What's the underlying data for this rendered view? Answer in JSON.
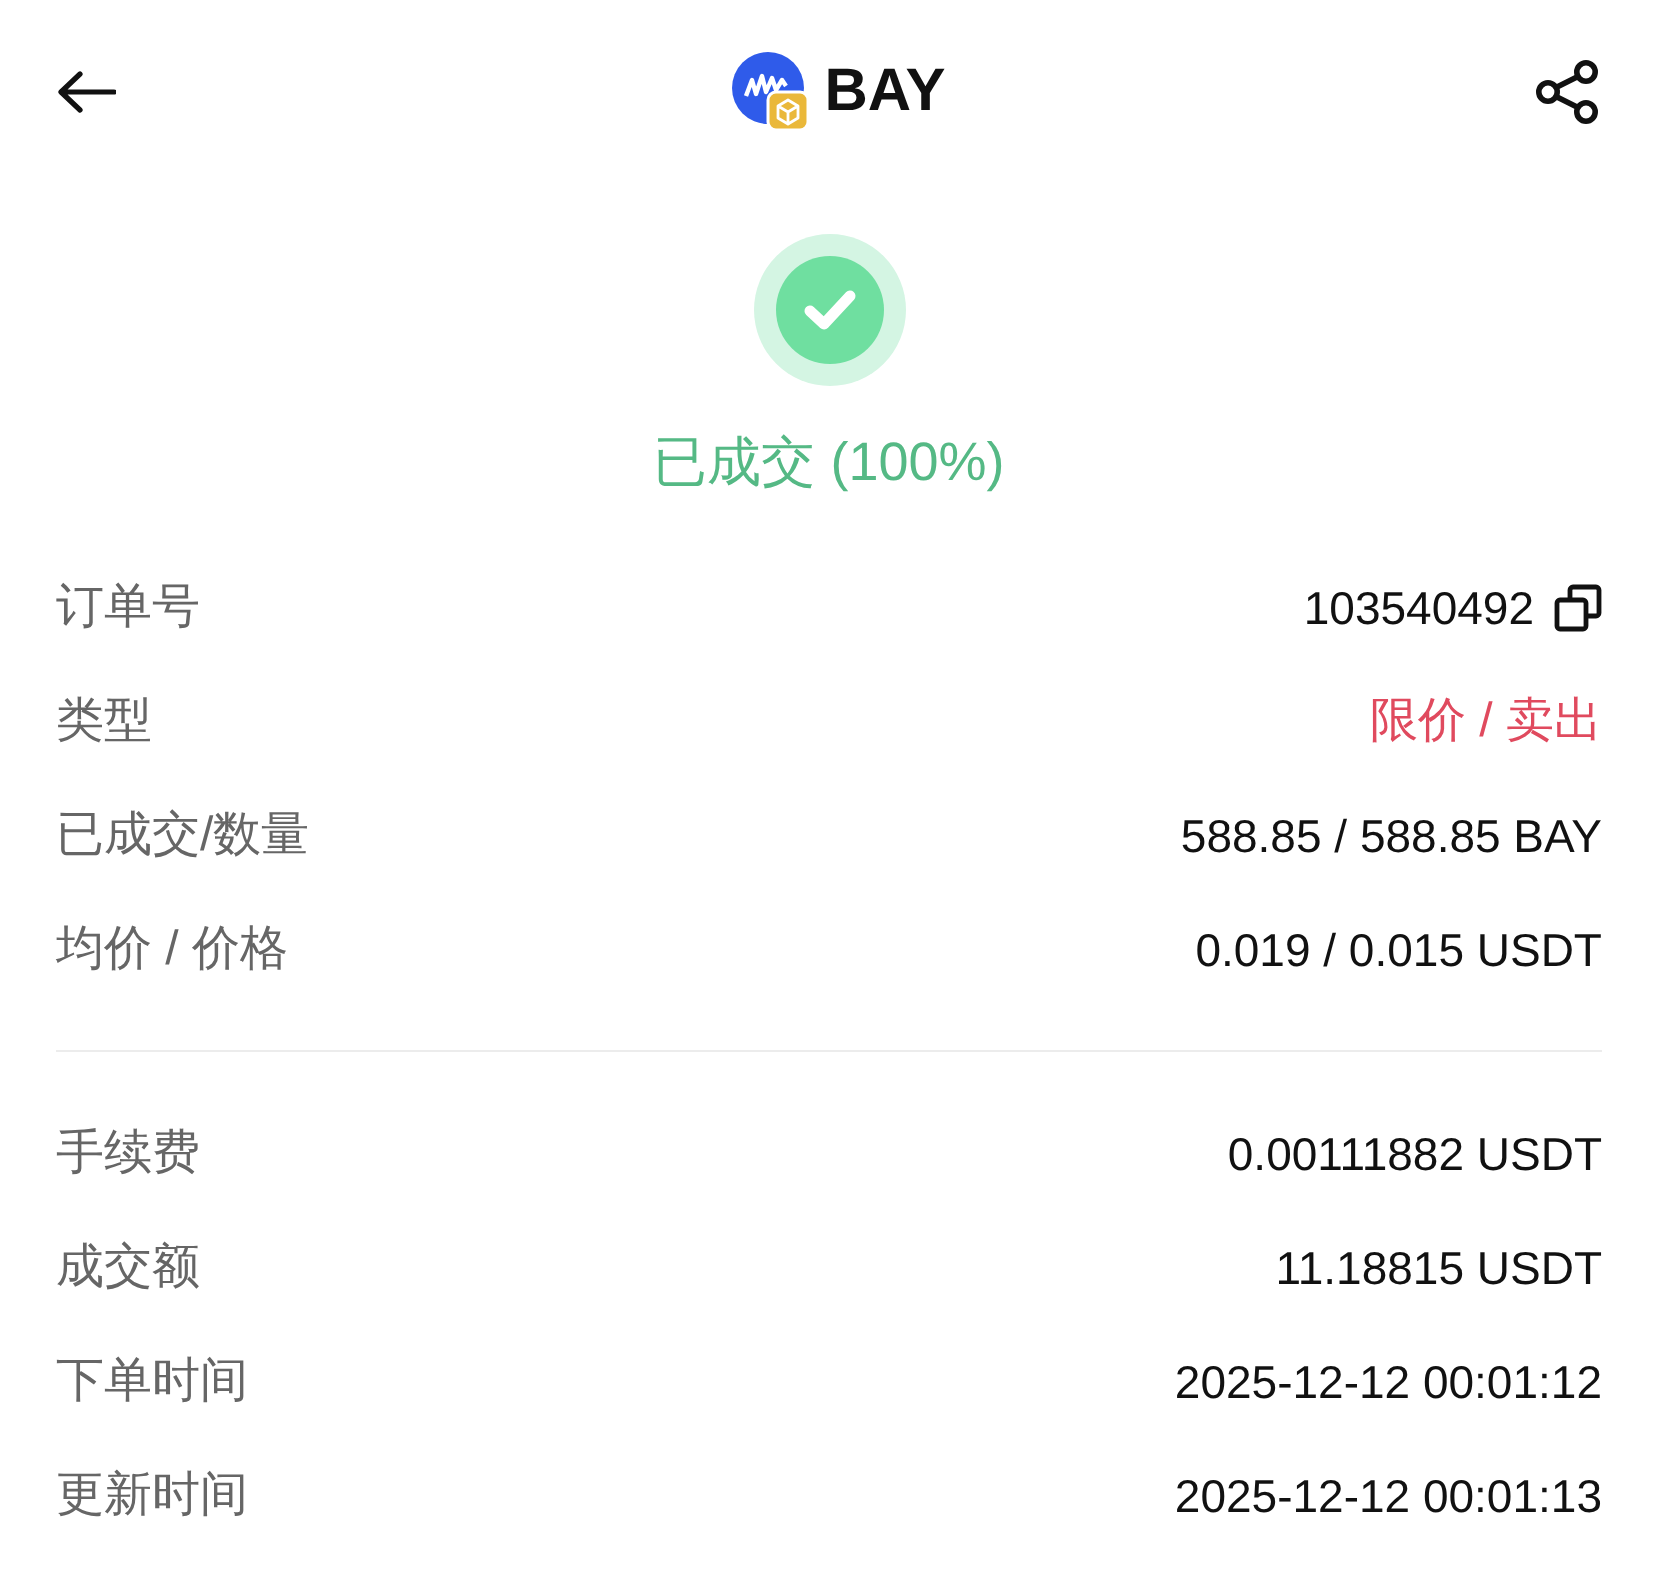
{
  "header": {
    "title": "BAY"
  },
  "status": {
    "kind": "success",
    "label": "已成交 (100%)"
  },
  "sections": [
    {
      "rows": [
        {
          "label": "订单号",
          "value": "103540492",
          "kind": "copy"
        },
        {
          "label": "类型",
          "value": "限价 / 卖出",
          "kind": "sell"
        },
        {
          "label": "已成交/数量",
          "value": "588.85 / 588.85 BAY",
          "kind": "text"
        },
        {
          "label": "均价 / 价格",
          "value": "0.019 / 0.015 USDT",
          "kind": "text"
        }
      ]
    },
    {
      "rows": [
        {
          "label": "手续费",
          "value": "0.00111882 USDT",
          "kind": "text"
        },
        {
          "label": "成交额",
          "value": "11.18815 USDT",
          "kind": "text"
        },
        {
          "label": "下单时间",
          "value": "2025-12-12 00:01:12",
          "kind": "text"
        },
        {
          "label": "更新时间",
          "value": "2025-12-12 00:01:13",
          "kind": "text"
        }
      ]
    }
  ]
}
